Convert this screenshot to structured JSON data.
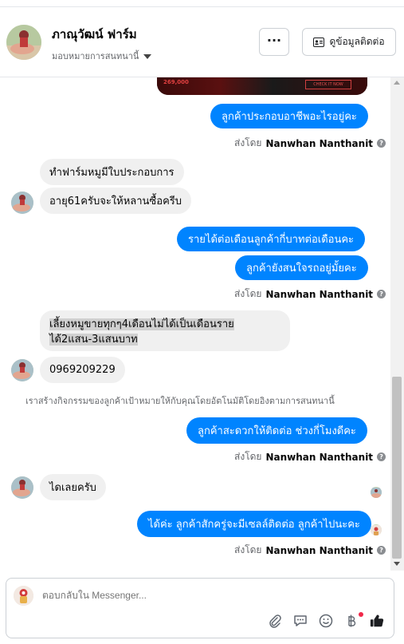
{
  "header": {
    "page_name": "ภาณุวัฒน์ ฟาร์ม",
    "assign_label": "มอบหมายการสนทนานี้",
    "more_label": "···",
    "contact_label": "ดูข้อมูลติดต่อ"
  },
  "promo_image": {
    "left_text": "269,000",
    "button_text": "CHECK IT NOW"
  },
  "messages": [
    {
      "dir": "out",
      "text": "ลูกค้าประกอบอาชีพอะไรอยู่คะ"
    },
    {
      "dir": "sent_by",
      "prefix": "ส่งโดย",
      "name": "Nanwhan Nanthanit"
    },
    {
      "dir": "in",
      "text": "ทำฟาร์มหมูมีใบประกอบการ"
    },
    {
      "dir": "in",
      "text": "อายุ61ครับจะให้หลานซื้อครีบ"
    },
    {
      "dir": "out",
      "text": "รายได้ต่อเดือนลูกค้ากี่บาทต่อเดือนคะ"
    },
    {
      "dir": "out",
      "text": "ลูกค้ายังสนใจรถอยู่มั้ยคะ"
    },
    {
      "dir": "sent_by",
      "prefix": "ส่งโดย",
      "name": "Nanwhan Nanthanit"
    },
    {
      "dir": "in",
      "line1": "เลี้ยงหมูขายทุกๆ4เดือนไม่ได้เป็นเดือนราย",
      "line2": "ได้2แสน-3แสนบาท"
    },
    {
      "dir": "in",
      "text": "0969209229"
    },
    {
      "dir": "system",
      "text": "เราสร้างกิจกรรมของลูกค้าเป้าหมายให้กับคุณโดยอัตโนมัติโดยอิงตามการสนทนานี้"
    },
    {
      "dir": "out",
      "text": "ลูกค้าสะดวกให้ติดต่อ ช่วงกี่โมงดีคะ"
    },
    {
      "dir": "sent_by",
      "prefix": "ส่งโดย",
      "name": "Nanwhan Nanthanit"
    },
    {
      "dir": "in",
      "text": "ไดเลยครับ"
    },
    {
      "dir": "out",
      "text": "ได้ค่ะ ลูกค้าสักครู่จะมีเซลล์ติดต่อ ลูกค้าไปนะคะ"
    },
    {
      "dir": "sent_by",
      "prefix": "ส่งโดย",
      "name": "Nanwhan Nanthanit"
    }
  ],
  "composer": {
    "placeholder": "ตอบกลับใน Messenger..."
  },
  "colors": {
    "bubble_out": "#0084ff",
    "bubble_in": "#f0f0f0",
    "accent_dot": "#f02849"
  }
}
